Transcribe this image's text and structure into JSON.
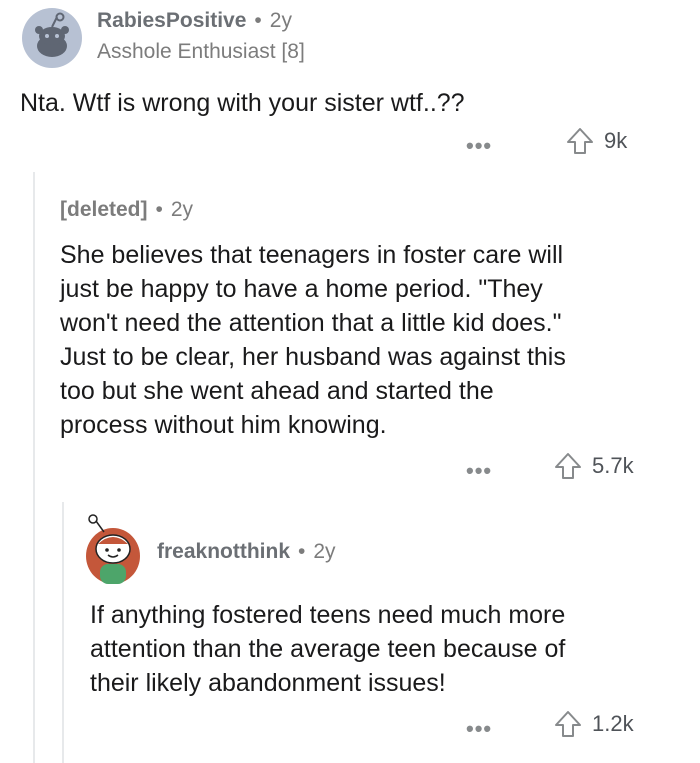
{
  "comments": [
    {
      "username": "RabiesPositive",
      "age": "2y",
      "flair": "Asshole Enthusiast [8]",
      "body": "Nta. Wtf is wrong with your sister wtf..??",
      "more": "•••",
      "votes": "9k"
    },
    {
      "username": "[deleted]",
      "age": "2y",
      "body_lines": [
        "She believes that teenagers in foster care will",
        "just be happy to have a home period. \"They",
        "won't need the attention that a little kid does.\"",
        "Just to be clear, her husband was against this",
        "too but she went ahead and started the",
        "process without him knowing."
      ],
      "more": "•••",
      "votes": "5.7k"
    },
    {
      "username": "freaknotthink",
      "age": "2y",
      "body_lines": [
        "If anything fostered teens need much more",
        "attention than the average teen because of",
        "their likely abandonment issues!"
      ],
      "more": "•••",
      "votes": "1.2k"
    }
  ],
  "separator": "•"
}
